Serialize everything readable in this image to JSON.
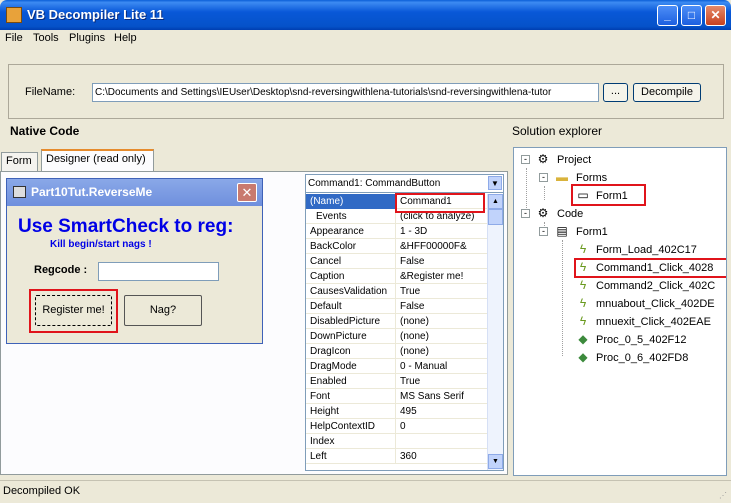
{
  "window": {
    "title": "VB Decompiler Lite 11"
  },
  "menu": [
    "File",
    "Tools",
    "Plugins",
    "Help"
  ],
  "file": {
    "label": "FileName:",
    "path": "C:\\Documents and Settings\\IEUser\\Desktop\\snd-reversingwithlena-tutorials\\snd-reversingwithlena-tutor",
    "browse_label": "...",
    "decompile_label": "Decompile"
  },
  "native_code_title": "Native Code",
  "solution_title": "Solution explorer",
  "tabs": [
    "Form",
    "Designer (read only)"
  ],
  "vbform": {
    "title": "Part10Tut.ReverseMe",
    "big_text": "Use SmartCheck to reg:",
    "small_text": "Kill begin/start nags !",
    "regcode_label": "Regcode :",
    "register_label": "Register me!",
    "nag_label": "Nag?"
  },
  "properties": {
    "object": "Command1: CommandButton",
    "rows": [
      {
        "name": "(Name)",
        "value": "Command1"
      },
      {
        "name": "Events",
        "value": "(click to analyze)"
      },
      {
        "name": "Appearance",
        "value": "1 - 3D"
      },
      {
        "name": "BackColor",
        "value": "&HFF00000F&"
      },
      {
        "name": "Cancel",
        "value": "False"
      },
      {
        "name": "Caption",
        "value": "&Register me!"
      },
      {
        "name": "CausesValidation",
        "value": "True"
      },
      {
        "name": "Default",
        "value": "False"
      },
      {
        "name": "DisabledPicture",
        "value": "(none)"
      },
      {
        "name": "DownPicture",
        "value": "(none)"
      },
      {
        "name": "DragIcon",
        "value": "(none)"
      },
      {
        "name": "DragMode",
        "value": "0 - Manual"
      },
      {
        "name": "Enabled",
        "value": "True"
      },
      {
        "name": "Font",
        "value": "MS Sans Serif"
      },
      {
        "name": "Height",
        "value": "495"
      },
      {
        "name": "HelpContextID",
        "value": "0"
      },
      {
        "name": "Index",
        "value": ""
      },
      {
        "name": "Left",
        "value": "360"
      }
    ]
  },
  "tree": {
    "project": "Project",
    "forms": "Forms",
    "form1": "Form1",
    "code": "Code",
    "code_form1": "Form1",
    "items": [
      "Form_Load_402C17",
      "Command1_Click_4028",
      "Command2_Click_402C",
      "mnuabout_Click_402DE",
      "mnuexit_Click_402EAE",
      "Proc_0_5_402F12",
      "Proc_0_6_402FD8"
    ]
  },
  "status": "Decompiled OK"
}
